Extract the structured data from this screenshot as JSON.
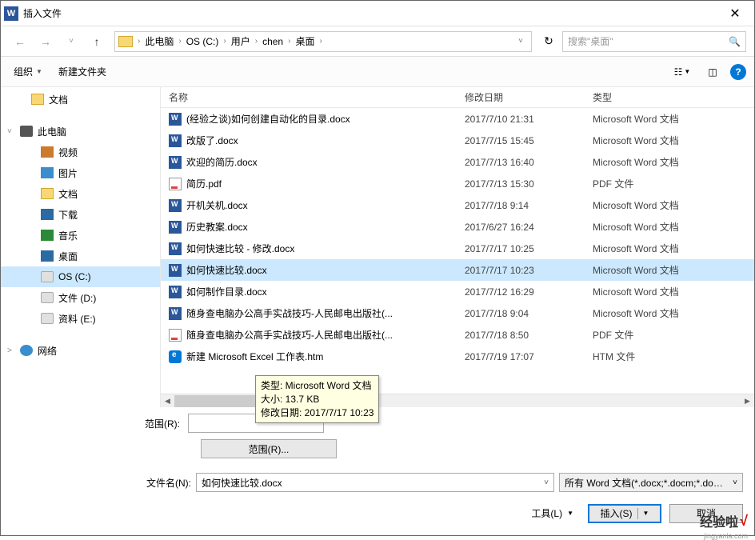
{
  "window": {
    "title": "插入文件"
  },
  "breadcrumb": {
    "items": [
      "此电脑",
      "OS (C:)",
      "用户",
      "chen",
      "桌面"
    ]
  },
  "search": {
    "placeholder": "搜索\"桌面\""
  },
  "toolbar": {
    "organize": "组织",
    "newfolder": "新建文件夹"
  },
  "sidebar": {
    "items": [
      {
        "label": "文档",
        "icon": "folder",
        "indent": 38
      },
      {
        "label": "此电脑",
        "icon": "pc",
        "indent": 24,
        "chev": "˅",
        "bold": true
      },
      {
        "label": "视频",
        "icon": "vid",
        "indent": 50
      },
      {
        "label": "图片",
        "icon": "pic",
        "indent": 50
      },
      {
        "label": "文档",
        "icon": "folder",
        "indent": 50
      },
      {
        "label": "下载",
        "icon": "download",
        "indent": 50
      },
      {
        "label": "音乐",
        "icon": "music",
        "indent": 50
      },
      {
        "label": "桌面",
        "icon": "desktop",
        "indent": 50
      },
      {
        "label": "OS (C:)",
        "icon": "drive",
        "indent": 50,
        "selected": true
      },
      {
        "label": "文件 (D:)",
        "icon": "drive",
        "indent": 50
      },
      {
        "label": "资料 (E:)",
        "icon": "drive",
        "indent": 50
      },
      {
        "label": "网络",
        "icon": "net",
        "indent": 24,
        "chev": ">"
      }
    ]
  },
  "columns": {
    "name": "名称",
    "date": "修改日期",
    "type": "类型"
  },
  "files": [
    {
      "icon": "word",
      "name": "(经验之谈)如何创建自动化的目录.docx",
      "date": "2017/7/10 21:31",
      "type": "Microsoft Word 文档"
    },
    {
      "icon": "word",
      "name": "改版了.docx",
      "date": "2017/7/15 15:45",
      "type": "Microsoft Word 文档"
    },
    {
      "icon": "word",
      "name": "欢迎的简历.docx",
      "date": "2017/7/13 16:40",
      "type": "Microsoft Word 文档"
    },
    {
      "icon": "pdf",
      "name": "简历.pdf",
      "date": "2017/7/13 15:30",
      "type": "PDF 文件"
    },
    {
      "icon": "word",
      "name": "开机关机.docx",
      "date": "2017/7/18 9:14",
      "type": "Microsoft Word 文档"
    },
    {
      "icon": "word",
      "name": "历史教案.docx",
      "date": "2017/6/27 16:24",
      "type": "Microsoft Word 文档"
    },
    {
      "icon": "word",
      "name": "如何快速比较 - 修改.docx",
      "date": "2017/7/17 10:25",
      "type": "Microsoft Word 文档"
    },
    {
      "icon": "word",
      "name": "如何快速比较.docx",
      "date": "2017/7/17 10:23",
      "type": "Microsoft Word 文档",
      "selected": true
    },
    {
      "icon": "word",
      "name": "如何制作目录.docx",
      "date": "2017/7/12 16:29",
      "type": "Microsoft Word 文档"
    },
    {
      "icon": "word",
      "name": "随身查电脑办公高手实战技巧-人民邮电出版社(...",
      "date": "2017/7/18 9:04",
      "type": "Microsoft Word 文档"
    },
    {
      "icon": "pdf",
      "name": "随身查电脑办公高手实战技巧-人民邮电出版社(...",
      "date": "2017/7/18 8:50",
      "type": "PDF 文件"
    },
    {
      "icon": "edge",
      "name": "新建 Microsoft Excel 工作表.htm",
      "date": "2017/7/19 17:07",
      "type": "HTM 文件"
    }
  ],
  "tooltip": {
    "line1": "类型: Microsoft Word 文档",
    "line2": "大小: 13.7 KB",
    "line3": "修改日期: 2017/7/17 10:23"
  },
  "range": {
    "label": "范围(R):",
    "btn": "范围(R)..."
  },
  "filename": {
    "label": "文件名(N):",
    "value": "如何快速比较.docx"
  },
  "filter": {
    "text": "所有 Word 文档(*.docx;*.docm;*.doc;...)"
  },
  "tools": {
    "label": "工具(L)"
  },
  "actions": {
    "insert": "插入(S)",
    "cancel": "取消"
  },
  "watermark": {
    "brand": "经验啦",
    "url": "jingyanla.com"
  }
}
